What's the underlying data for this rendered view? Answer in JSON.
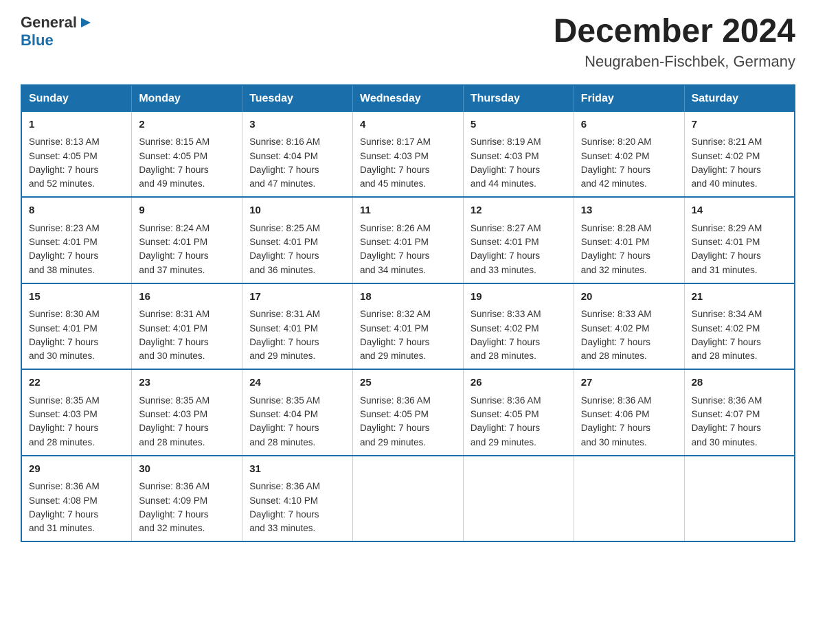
{
  "logo": {
    "general": "General",
    "blue": "Blue"
  },
  "header": {
    "month": "December 2024",
    "location": "Neugraben-Fischbek, Germany"
  },
  "weekdays": [
    "Sunday",
    "Monday",
    "Tuesday",
    "Wednesday",
    "Thursday",
    "Friday",
    "Saturday"
  ],
  "weeks": [
    [
      {
        "day": "1",
        "sunrise": "8:13 AM",
        "sunset": "4:05 PM",
        "daylight": "7 hours and 52 minutes."
      },
      {
        "day": "2",
        "sunrise": "8:15 AM",
        "sunset": "4:05 PM",
        "daylight": "7 hours and 49 minutes."
      },
      {
        "day": "3",
        "sunrise": "8:16 AM",
        "sunset": "4:04 PM",
        "daylight": "7 hours and 47 minutes."
      },
      {
        "day": "4",
        "sunrise": "8:17 AM",
        "sunset": "4:03 PM",
        "daylight": "7 hours and 45 minutes."
      },
      {
        "day": "5",
        "sunrise": "8:19 AM",
        "sunset": "4:03 PM",
        "daylight": "7 hours and 44 minutes."
      },
      {
        "day": "6",
        "sunrise": "8:20 AM",
        "sunset": "4:02 PM",
        "daylight": "7 hours and 42 minutes."
      },
      {
        "day": "7",
        "sunrise": "8:21 AM",
        "sunset": "4:02 PM",
        "daylight": "7 hours and 40 minutes."
      }
    ],
    [
      {
        "day": "8",
        "sunrise": "8:23 AM",
        "sunset": "4:01 PM",
        "daylight": "7 hours and 38 minutes."
      },
      {
        "day": "9",
        "sunrise": "8:24 AM",
        "sunset": "4:01 PM",
        "daylight": "7 hours and 37 minutes."
      },
      {
        "day": "10",
        "sunrise": "8:25 AM",
        "sunset": "4:01 PM",
        "daylight": "7 hours and 36 minutes."
      },
      {
        "day": "11",
        "sunrise": "8:26 AM",
        "sunset": "4:01 PM",
        "daylight": "7 hours and 34 minutes."
      },
      {
        "day": "12",
        "sunrise": "8:27 AM",
        "sunset": "4:01 PM",
        "daylight": "7 hours and 33 minutes."
      },
      {
        "day": "13",
        "sunrise": "8:28 AM",
        "sunset": "4:01 PM",
        "daylight": "7 hours and 32 minutes."
      },
      {
        "day": "14",
        "sunrise": "8:29 AM",
        "sunset": "4:01 PM",
        "daylight": "7 hours and 31 minutes."
      }
    ],
    [
      {
        "day": "15",
        "sunrise": "8:30 AM",
        "sunset": "4:01 PM",
        "daylight": "7 hours and 30 minutes."
      },
      {
        "day": "16",
        "sunrise": "8:31 AM",
        "sunset": "4:01 PM",
        "daylight": "7 hours and 30 minutes."
      },
      {
        "day": "17",
        "sunrise": "8:31 AM",
        "sunset": "4:01 PM",
        "daylight": "7 hours and 29 minutes."
      },
      {
        "day": "18",
        "sunrise": "8:32 AM",
        "sunset": "4:01 PM",
        "daylight": "7 hours and 29 minutes."
      },
      {
        "day": "19",
        "sunrise": "8:33 AM",
        "sunset": "4:02 PM",
        "daylight": "7 hours and 28 minutes."
      },
      {
        "day": "20",
        "sunrise": "8:33 AM",
        "sunset": "4:02 PM",
        "daylight": "7 hours and 28 minutes."
      },
      {
        "day": "21",
        "sunrise": "8:34 AM",
        "sunset": "4:02 PM",
        "daylight": "7 hours and 28 minutes."
      }
    ],
    [
      {
        "day": "22",
        "sunrise": "8:35 AM",
        "sunset": "4:03 PM",
        "daylight": "7 hours and 28 minutes."
      },
      {
        "day": "23",
        "sunrise": "8:35 AM",
        "sunset": "4:03 PM",
        "daylight": "7 hours and 28 minutes."
      },
      {
        "day": "24",
        "sunrise": "8:35 AM",
        "sunset": "4:04 PM",
        "daylight": "7 hours and 28 minutes."
      },
      {
        "day": "25",
        "sunrise": "8:36 AM",
        "sunset": "4:05 PM",
        "daylight": "7 hours and 29 minutes."
      },
      {
        "day": "26",
        "sunrise": "8:36 AM",
        "sunset": "4:05 PM",
        "daylight": "7 hours and 29 minutes."
      },
      {
        "day": "27",
        "sunrise": "8:36 AM",
        "sunset": "4:06 PM",
        "daylight": "7 hours and 30 minutes."
      },
      {
        "day": "28",
        "sunrise": "8:36 AM",
        "sunset": "4:07 PM",
        "daylight": "7 hours and 30 minutes."
      }
    ],
    [
      {
        "day": "29",
        "sunrise": "8:36 AM",
        "sunset": "4:08 PM",
        "daylight": "7 hours and 31 minutes."
      },
      {
        "day": "30",
        "sunrise": "8:36 AM",
        "sunset": "4:09 PM",
        "daylight": "7 hours and 32 minutes."
      },
      {
        "day": "31",
        "sunrise": "8:36 AM",
        "sunset": "4:10 PM",
        "daylight": "7 hours and 33 minutes."
      },
      null,
      null,
      null,
      null
    ]
  ],
  "labels": {
    "sunrise": "Sunrise:",
    "sunset": "Sunset:",
    "daylight": "Daylight:"
  }
}
